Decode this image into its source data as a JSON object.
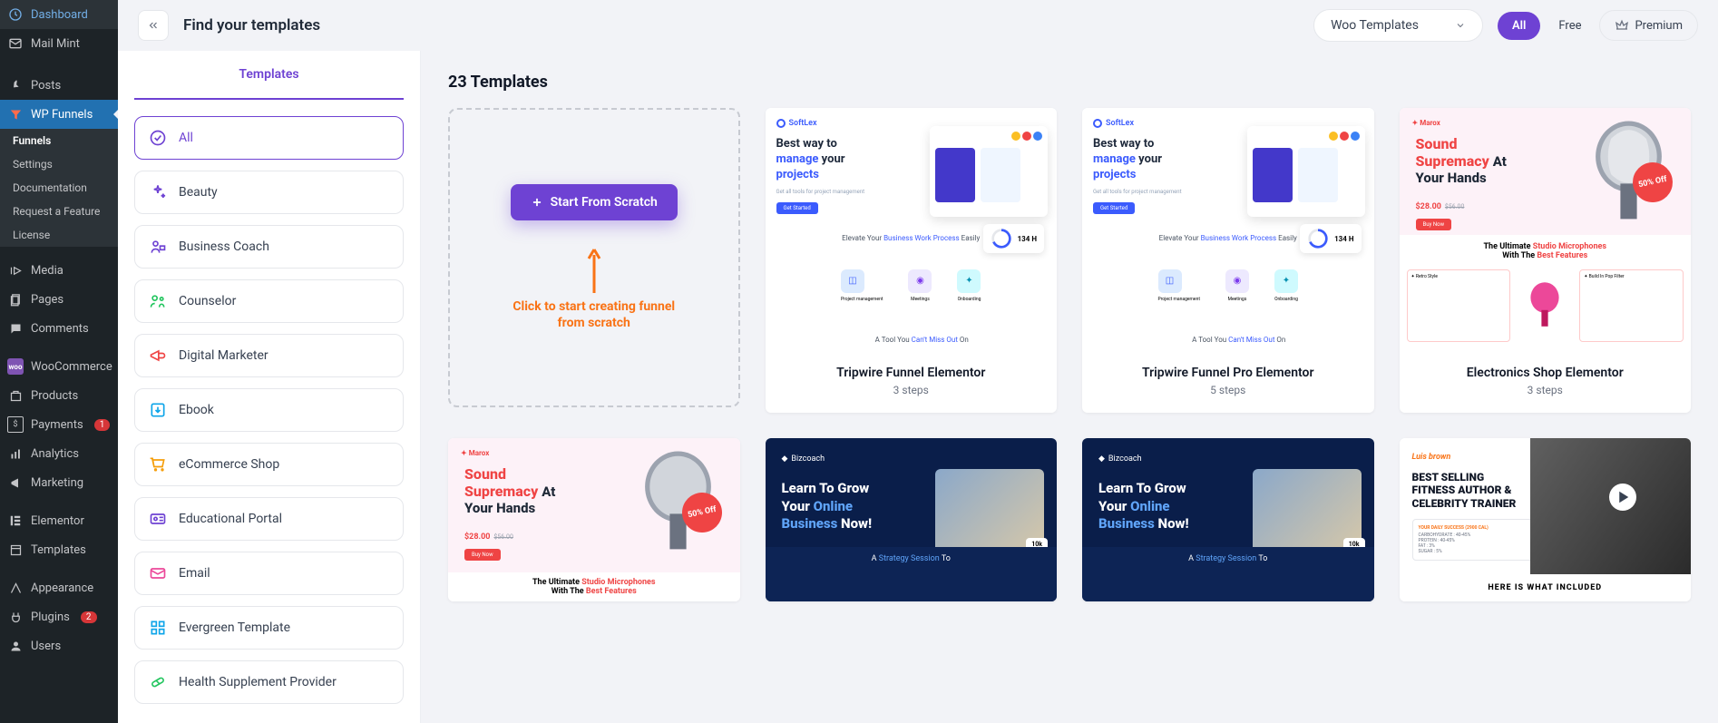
{
  "wp_sidebar": {
    "items": [
      {
        "label": "Dashboard",
        "icon": "dashboard"
      },
      {
        "label": "Mail Mint",
        "icon": "mail"
      },
      {
        "label": "Posts",
        "icon": "pin"
      },
      {
        "label": "WP Funnels",
        "icon": "funnel",
        "active": true
      },
      {
        "label": "Media",
        "icon": "media"
      },
      {
        "label": "Pages",
        "icon": "pages"
      },
      {
        "label": "Comments",
        "icon": "comments"
      },
      {
        "label": "WooCommerce",
        "icon": "woo"
      },
      {
        "label": "Products",
        "icon": "products"
      },
      {
        "label": "Payments",
        "icon": "payments",
        "badge": "1"
      },
      {
        "label": "Analytics",
        "icon": "analytics"
      },
      {
        "label": "Marketing",
        "icon": "marketing"
      },
      {
        "label": "Elementor",
        "icon": "elementor"
      },
      {
        "label": "Templates",
        "icon": "templates"
      },
      {
        "label": "Appearance",
        "icon": "appearance"
      },
      {
        "label": "Plugins",
        "icon": "plugins",
        "badge": "2"
      },
      {
        "label": "Users",
        "icon": "users"
      }
    ],
    "submenu": [
      {
        "label": "Funnels",
        "sel": true
      },
      {
        "label": "Settings"
      },
      {
        "label": "Documentation"
      },
      {
        "label": "Request a Feature"
      },
      {
        "label": "License"
      }
    ]
  },
  "topbar": {
    "title": "Find your templates",
    "select_label": "Woo Templates",
    "seg_all": "All",
    "seg_free": "Free",
    "seg_premium": "Premium"
  },
  "categories_tab": "Templates",
  "categories": [
    {
      "label": "All",
      "active": true
    },
    {
      "label": "Beauty"
    },
    {
      "label": "Business Coach"
    },
    {
      "label": "Counselor"
    },
    {
      "label": "Digital Marketer"
    },
    {
      "label": "Ebook"
    },
    {
      "label": "eCommerce Shop"
    },
    {
      "label": "Educational Portal"
    },
    {
      "label": "Email"
    },
    {
      "label": "Evergreen Template"
    },
    {
      "label": "Health Supplement Provider"
    }
  ],
  "grid_heading": "23 Templates",
  "scratch": {
    "button": "Start From Scratch",
    "annotation_l1": "Click to start creating funnel",
    "annotation_l2": "from scratch"
  },
  "templates": [
    {
      "title": "Tripwire Funnel Elementor",
      "steps": "3 steps",
      "variant": "soft"
    },
    {
      "title": "Tripwire Funnel Pro Elementor",
      "steps": "5 steps",
      "variant": "soft"
    },
    {
      "title": "Electronics Shop Elementor",
      "steps": "3 steps",
      "variant": "mic"
    }
  ],
  "thumb_text": {
    "soft": {
      "brand": "SoftLex",
      "h1": "Best way to",
      "h2": "manage",
      "h3": "your",
      "h4": "projects",
      "elevate_pre": "Elevate Your",
      "elevate_hl": "Business Work Process",
      "elevate_post": "Easily",
      "chip1": "Project management",
      "chip2": "Meetings",
      "chip3": "Onboarding",
      "foot_pre": "A Tool You",
      "foot_hl": "Can't Miss Out",
      "foot_post": "On"
    },
    "mic": {
      "brand": "Marox",
      "title_l1": "Sound",
      "title_l2": "Supremacy",
      "title_l2b": "At",
      "title_l3": "Your Hands",
      "badge": "50% Off",
      "strip_pre": "The Ultimate",
      "strip_hl": "Studio Microphones",
      "strip_line2_pre": "With The",
      "strip_line2_hl": "Best Features"
    },
    "biz": {
      "brand": "Bizcoach",
      "l1": "Learn To Grow",
      "l2": "Your",
      "l2hl": "Online",
      "l3hl": "Business",
      "l3": "Now!",
      "foot_pre": "A",
      "foot_hl": "Strategy Session",
      "foot_post": "To"
    },
    "fit": {
      "brand": "Luis brown",
      "l1": "BEST SELLING",
      "l2": "FITNESS AUTHOR &",
      "l3": "CELEBRITY TRAINER",
      "bottom": "HERE IS WHAT INCLUDED"
    }
  }
}
